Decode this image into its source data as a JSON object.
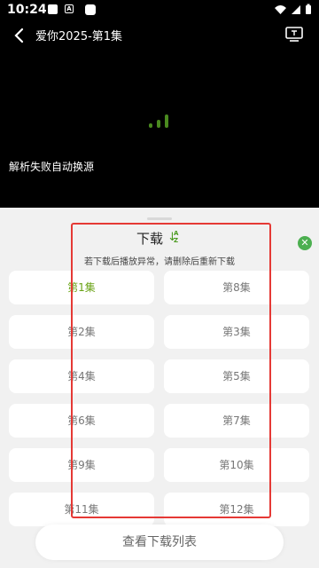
{
  "status_bar": {
    "time": "10:24",
    "a_icon_letter": "A"
  },
  "player": {
    "title": "爱你2025-第1集",
    "parse_message": "解析失败自动换源"
  },
  "sheet": {
    "title": "下载",
    "sort_az": "A Z",
    "tip": "若下载后播放异常，请删除后重新下载",
    "close_symbol": "✕",
    "episodes_left": [
      "第1集",
      "第2集",
      "第4集",
      "第6集",
      "第9集",
      "第11集"
    ],
    "episodes_right": [
      "第8集",
      "第3集",
      "第5集",
      "第7集",
      "第10集",
      "第12集"
    ],
    "selected": "第1集",
    "view_list_button": "查看下载列表"
  },
  "colors": {
    "accent": "#6aa316",
    "close_green": "#4caf50",
    "highlight_red": "#e53935",
    "sheet_bg": "#f1f1f1"
  },
  "icons": [
    "image-icon",
    "a-icon",
    "notification-icon",
    "wifi-icon",
    "signal-icon",
    "battery-icon",
    "back-icon",
    "tv-cast-icon",
    "loading-icon",
    "sort-icon",
    "close-icon"
  ]
}
